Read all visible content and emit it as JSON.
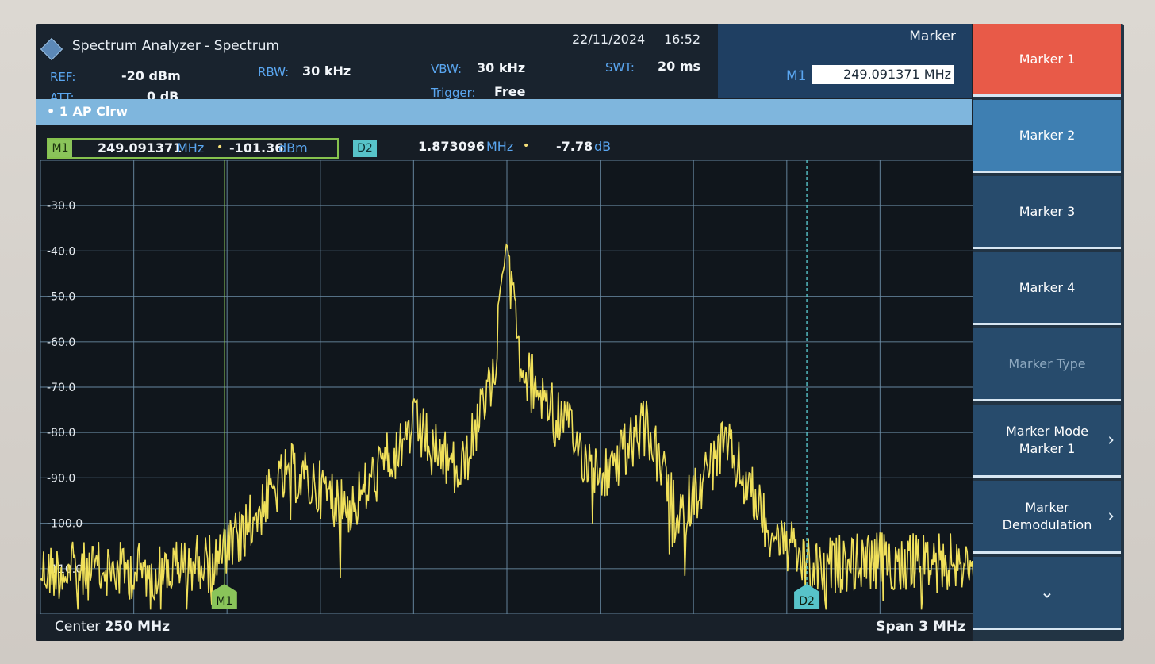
{
  "titlebar": {
    "title": "Spectrum Analyzer - Spectrum",
    "date": "22/11/2024",
    "time": "16:52",
    "params": {
      "ref_label": "REF:",
      "ref_value": "-20 dBm",
      "att_label": "ATT:",
      "att_value": "0 dB",
      "rbw_label": "RBW:",
      "rbw_value": "30 kHz",
      "vbw_label": "VBW:",
      "vbw_value": "30 kHz",
      "trigger_label": "Trigger:",
      "trigger_value": "Free",
      "swt_label": "SWT:",
      "swt_value": "20 ms"
    }
  },
  "marker_header": {
    "title": "Marker",
    "field_label": "M1",
    "field_value": "249.091371 MHz"
  },
  "trace_label": "• 1 AP Clrw",
  "marker_info": {
    "m1_tag": "M1",
    "m1_freq": "249.091371",
    "m1_freq_unit": "MHz",
    "m1_level": "-101.36",
    "m1_level_unit": "dBm",
    "dot": "•",
    "d2_tag": "D2",
    "d2_freq": "1.873096",
    "d2_freq_unit": "MHz",
    "d2_level": "-7.78",
    "d2_level_unit": "dB"
  },
  "chart_data": {
    "type": "line",
    "x_range_mhz": [
      248.5,
      251.5
    ],
    "ylim": [
      -120,
      -20
    ],
    "y_ticks": [
      "-30.0",
      "-40.0",
      "-50.0",
      "-60.0",
      "-70.0",
      "-80.0",
      "-90.0",
      "-100.0",
      "-110.0"
    ],
    "grid": true,
    "trace_color": "#f0e05a",
    "envelope": {
      "x_mhz": [
        248.5,
        248.9,
        249.1,
        249.3,
        249.5,
        249.7,
        249.85,
        249.95,
        250.0,
        250.05,
        250.15,
        250.3,
        250.45,
        250.55,
        250.7,
        250.85,
        250.98,
        251.1,
        251.5
      ],
      "y_dbm": [
        -104,
        -104,
        -100,
        -82,
        -90,
        -72,
        -83,
        -63,
        -37,
        -60,
        -68,
        -84,
        -72,
        -93,
        -76,
        -95,
        -104,
        -102,
        -102
      ]
    },
    "markers": [
      {
        "label": "M1",
        "x_mhz": 249.091371,
        "y_dbm": -101.36,
        "color": "#8ac45a"
      },
      {
        "label": "D2",
        "x_mhz": 250.964467,
        "y_dbm": -101.36,
        "color": "#57c3c9"
      }
    ],
    "center": "Center 250 MHz",
    "span": "Span 3 MHz"
  },
  "bottom": {
    "center_label": "Center",
    "center_value": "250 MHz",
    "span_label": "Span 3 MHz"
  },
  "softkeys": [
    {
      "label": "Marker 1",
      "state": "active"
    },
    {
      "label": "Marker 2",
      "state": "selected"
    },
    {
      "label": "Marker 3",
      "state": "normal"
    },
    {
      "label": "Marker 4",
      "state": "normal"
    },
    {
      "label": "Marker Type",
      "state": "disabled"
    },
    {
      "label": "Marker Mode\nMarker 1",
      "state": "normal",
      "chevron": "›"
    },
    {
      "label": "Marker\nDemodulation",
      "state": "normal",
      "chevron": "›"
    },
    {
      "label": "",
      "state": "normal",
      "chevron": "⌄"
    }
  ],
  "colors": {
    "accent_active": "#e85a48",
    "marker1": "#8ac45a",
    "marker_delta": "#57c3c9",
    "label_blue": "#5aa6f0"
  }
}
